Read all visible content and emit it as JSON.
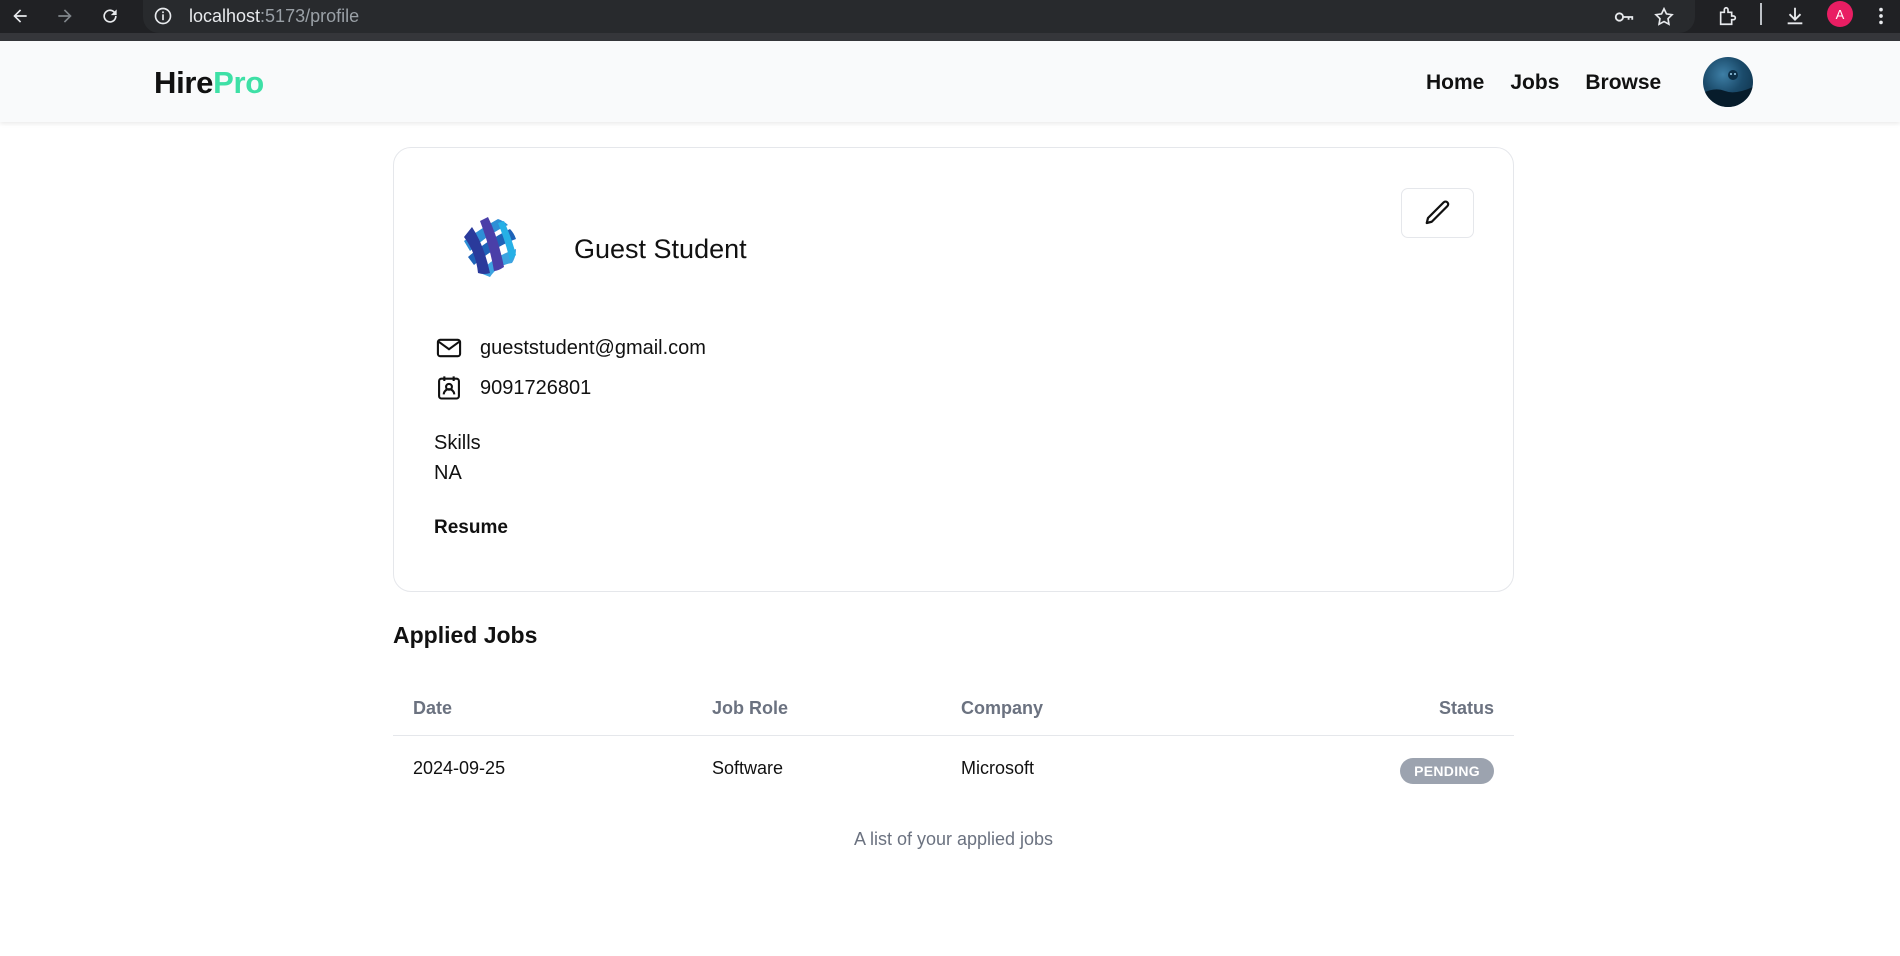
{
  "browser": {
    "url_host": "localhost",
    "url_rest": ":5173/profile",
    "profile_initial": "A"
  },
  "navbar": {
    "logo_primary": "Hire",
    "logo_accent": "Pro",
    "logo_accent_color": "#3ee0a6",
    "links": [
      {
        "label": "Home"
      },
      {
        "label": "Jobs"
      },
      {
        "label": "Browse"
      }
    ]
  },
  "profile": {
    "name": "Guest Student",
    "email": "gueststudent@gmail.com",
    "phone": "9091726801",
    "skills_label": "Skills",
    "skills_value": "NA",
    "resume_label": "Resume"
  },
  "applied_jobs": {
    "title": "Applied Jobs",
    "columns": [
      "Date",
      "Job Role",
      "Company",
      "Status"
    ],
    "rows": [
      {
        "date": "2024-09-25",
        "role": "Software",
        "company": "Microsoft",
        "status": "PENDING"
      }
    ],
    "caption": "A list of your applied jobs"
  },
  "colors": {
    "status_pending": "#9ca3af",
    "header_text": "#6b7280"
  }
}
